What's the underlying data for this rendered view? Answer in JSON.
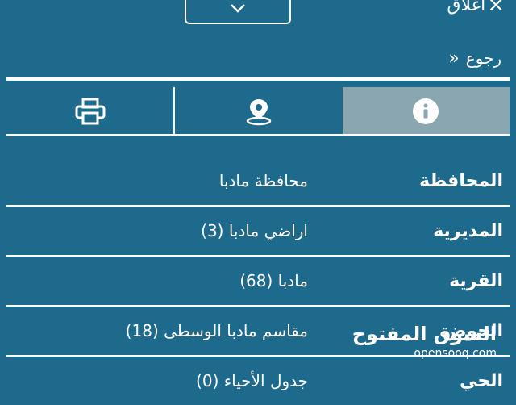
{
  "header": {
    "close_label": "اغلاق",
    "close_icon": "×",
    "back_label": "رجوع",
    "back_icon": "«"
  },
  "tabs": [
    {
      "name": "print",
      "icon": "printer-icon"
    },
    {
      "name": "location",
      "icon": "map-pin-icon"
    },
    {
      "name": "info",
      "icon": "info-icon",
      "active": true
    }
  ],
  "details": [
    {
      "label": "المحافظة",
      "value": "محافظة مادبا"
    },
    {
      "label": "المديرية",
      "value": "اراضي مادبا (3)"
    },
    {
      "label": "القرية",
      "value": "مادبا (68)"
    },
    {
      "label": "الحوض",
      "value": "مقاسم مادبا الوسطى (18)"
    },
    {
      "label": "الحي",
      "value": "جدول الأحياء (0)"
    }
  ],
  "watermark": {
    "arabic": "السوق المفتوح",
    "latin": "opensooq.com"
  },
  "colors": {
    "background": "#1e6a8c",
    "active_tab": "#8aa6b0",
    "foreground": "#ffffff"
  }
}
